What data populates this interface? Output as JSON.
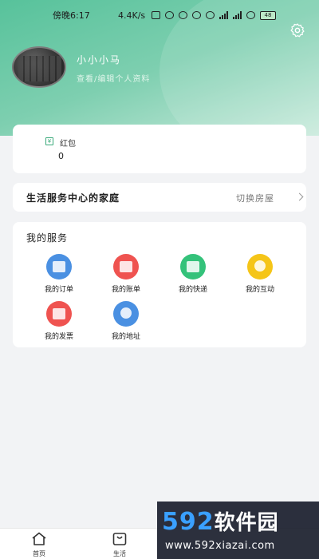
{
  "status_bar": {
    "time": "傍晚6:17",
    "speed": "4.4K/s",
    "battery": "48"
  },
  "profile": {
    "nickname": "小小小马",
    "edit_link": "查看/编辑个人资料"
  },
  "red_packet": {
    "label": "红包",
    "value": "0"
  },
  "family": {
    "name": "生活服务中心的家庭",
    "switch_label": "切换房屋"
  },
  "services": {
    "title": "我的服务",
    "items": [
      {
        "label": "我的订单",
        "icon": "order-icon",
        "color": "#4a90e2"
      },
      {
        "label": "我的账单",
        "icon": "bill-icon",
        "color": "#ef5350"
      },
      {
        "label": "我的快递",
        "icon": "delivery-icon",
        "color": "#34c27a"
      },
      {
        "label": "我的互动",
        "icon": "chat-icon",
        "color": "#f5c518"
      },
      {
        "label": "我的发票",
        "icon": "invoice-icon",
        "color": "#ef5350"
      },
      {
        "label": "我的地址",
        "icon": "location-icon",
        "color": "#4a90e2"
      }
    ]
  },
  "tabbar": {
    "items": [
      {
        "label": "首页",
        "icon": "home-icon"
      },
      {
        "label": "生活",
        "icon": "bag-icon"
      }
    ]
  },
  "watermark": {
    "brand_num": "592",
    "brand_cn": "软件园",
    "url": "www.592xiazai.com"
  },
  "colors": {
    "accent": "#57c29b",
    "background": "#f2f3f5"
  }
}
